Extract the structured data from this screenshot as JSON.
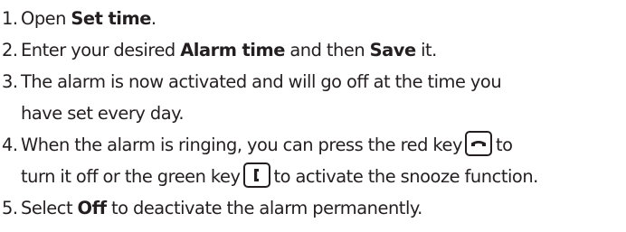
{
  "steps": [
    {
      "number": "1.",
      "open": "Open ",
      "set_time": "Set time",
      "end": "."
    },
    {
      "number": "2.",
      "enter": "Enter your desired ",
      "alarm_time": "Alarm time",
      "and_then": " and then ",
      "save": "Save",
      "it": " it."
    },
    {
      "number": "3.",
      "line1": "The alarm is now activated and will go off at the time you",
      "line2": "have set every day."
    },
    {
      "number": "4.",
      "line1_pre": "When the alarm is ringing, you can press the red key",
      "line1_post": "to",
      "line2_pre": "turn it off or the green key",
      "line2_post": "to activate the snooze function."
    },
    {
      "number": "5.",
      "select": "Select ",
      "off": "Off",
      "rest": " to deactivate the alarm permanently."
    }
  ],
  "icons": {
    "red_key": "end-call-key-icon",
    "green_key": "call-key-icon"
  }
}
